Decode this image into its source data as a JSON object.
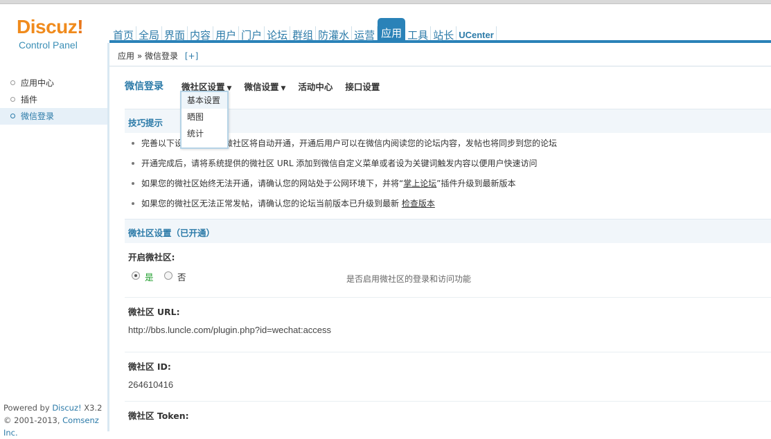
{
  "logo": {
    "brand": "Discuz",
    "bang": "!",
    "subtitle": "Control Panel"
  },
  "nav": [
    {
      "label": "首页"
    },
    {
      "label": "全局"
    },
    {
      "label": "界面"
    },
    {
      "label": "内容"
    },
    {
      "label": "用户"
    },
    {
      "label": "门户"
    },
    {
      "label": "论坛"
    },
    {
      "label": "群组"
    },
    {
      "label": "防灌水"
    },
    {
      "label": "运营"
    },
    {
      "label": "应用",
      "active": true
    },
    {
      "label": "工具"
    },
    {
      "label": "站长"
    },
    {
      "label": "UCenter"
    }
  ],
  "breadcrumb": {
    "parent": "应用",
    "sep": "»",
    "current": "微信登录",
    "add": "[+]"
  },
  "sidebar": {
    "items": [
      {
        "label": "应用中心"
      },
      {
        "label": "插件"
      },
      {
        "label": "微信登录",
        "active": true
      }
    ],
    "powered_prefix": "Powered by ",
    "powered_brand": "Discuz!",
    "powered_version": " X3.2",
    "copyright_prefix": "© 2001-2013, ",
    "copyright_company": "Comsenz Inc."
  },
  "subnav": {
    "title": "微信登录",
    "tabs": [
      {
        "label": "微社区设置",
        "has_menu": true
      },
      {
        "label": "微信设置",
        "has_menu": true
      },
      {
        "label": "活动中心",
        "has_menu": false
      },
      {
        "label": "接口设置",
        "has_menu": false
      }
    ],
    "dropdown": [
      "基本设置",
      "晒图",
      "统计"
    ]
  },
  "tips": {
    "title": "技巧提示",
    "items": [
      {
        "text": "完善以下设置后，您的微社区将自动开通，开通后用户可以在微信内阅读您的论坛内容，发帖也将同步到您的论坛"
      },
      {
        "text": "开通完成后，请将系统提供的微社区 URL 添加到微信自定义菜单或者设为关键词触发内容以便用户快速访问"
      },
      {
        "text_before": "如果您的微社区始终无法开通，请确认您的网站处于公网环境下，并将“",
        "link": "掌上论坛",
        "text_after": "”插件升级到最新版本"
      },
      {
        "text_before": "如果您的微社区无法正常发帖，请确认您的论坛当前版本已升级到最新 ",
        "link": "检查版本",
        "text_after": ""
      }
    ]
  },
  "settings": {
    "title": "微社区设置（已开通）",
    "enable_label": "开启微社区:",
    "yes_label": "是",
    "no_label": "否",
    "enable_hint": "是否启用微社区的登录和访问功能",
    "url_label": "微社区 URL:",
    "url_value": "http://bbs.luncle.com/plugin.php?id=wechat:access",
    "id_label": "微社区 ID:",
    "id_value": "264610416",
    "token_label": "微社区 Token:"
  },
  "colors": {
    "accent": "#2a82b8",
    "logo": "#f08b1d",
    "yes_green": "#1f9e2c"
  }
}
